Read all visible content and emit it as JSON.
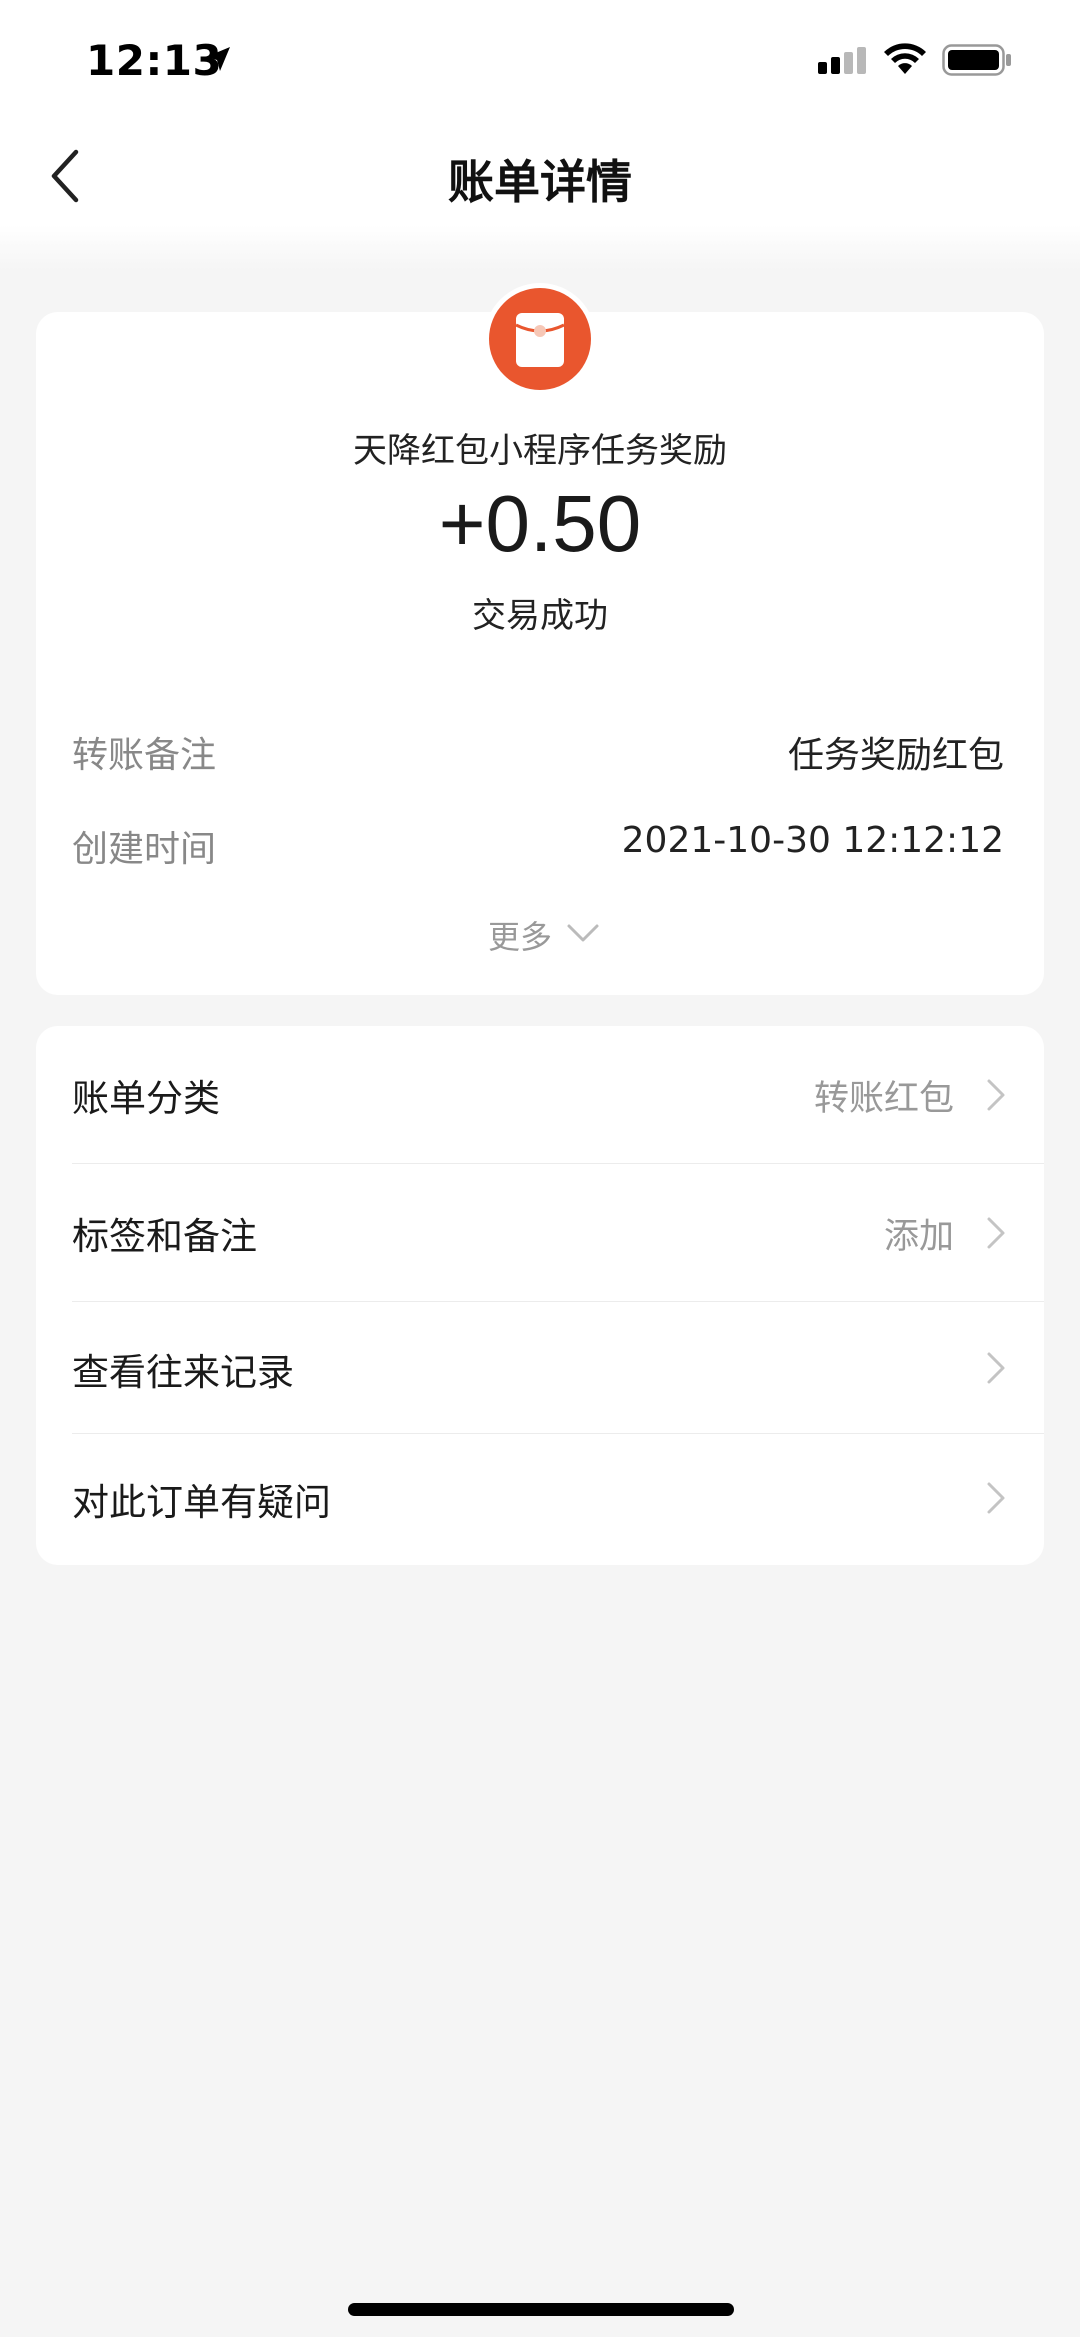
{
  "status_bar": {
    "time": "12:13",
    "icons": [
      "location-arrow-icon",
      "signal-icon",
      "wifi-icon",
      "battery-icon"
    ]
  },
  "nav": {
    "title": "账单详情",
    "back_icon": "chevron-left-icon"
  },
  "transaction": {
    "icon": "red-packet-icon",
    "icon_color": "#e9562e",
    "merchant": "天降红包小程序任务奖励",
    "amount": "+0.50",
    "status": "交易成功",
    "details": [
      {
        "label": "转账备注",
        "value": "任务奖励红包"
      },
      {
        "label": "创建时间",
        "value": "2021-10-30 12:12:12"
      }
    ],
    "more_label": "更多"
  },
  "menu": {
    "items": [
      {
        "label": "账单分类",
        "value": "转账红包"
      },
      {
        "label": "标签和备注",
        "value": "添加"
      },
      {
        "label": "查看往来记录",
        "value": ""
      },
      {
        "label": "对此订单有疑问",
        "value": ""
      }
    ]
  },
  "colors": {
    "accent": "#e9562e",
    "background": "#f5f5f5",
    "card": "#ffffff",
    "secondary_text": "#888888"
  }
}
